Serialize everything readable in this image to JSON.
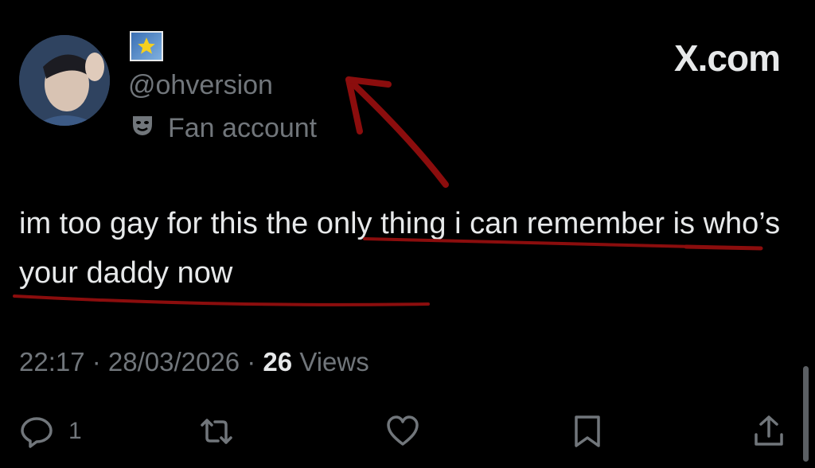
{
  "post": {
    "handle": "@ohversion",
    "label": "Fan account",
    "text": "im too gay for this the only thing i can remember is who’s your daddy now",
    "time": "22:17",
    "date": "28/03/2026",
    "views_count": "26",
    "views_label": "Views"
  },
  "brand": "X.com",
  "actions": {
    "reply_count": "1"
  },
  "icons": {
    "badge": "star-emoji-icon",
    "label": "theater-mask-icon",
    "reply": "reply-icon",
    "repost": "repost-icon",
    "like": "heart-icon",
    "bookmark": "bookmark-icon",
    "share": "share-icon"
  },
  "colors": {
    "background": "#000000",
    "text": "#e7e9ea",
    "muted": "#71767b",
    "annotation": "#8b0d0d"
  }
}
